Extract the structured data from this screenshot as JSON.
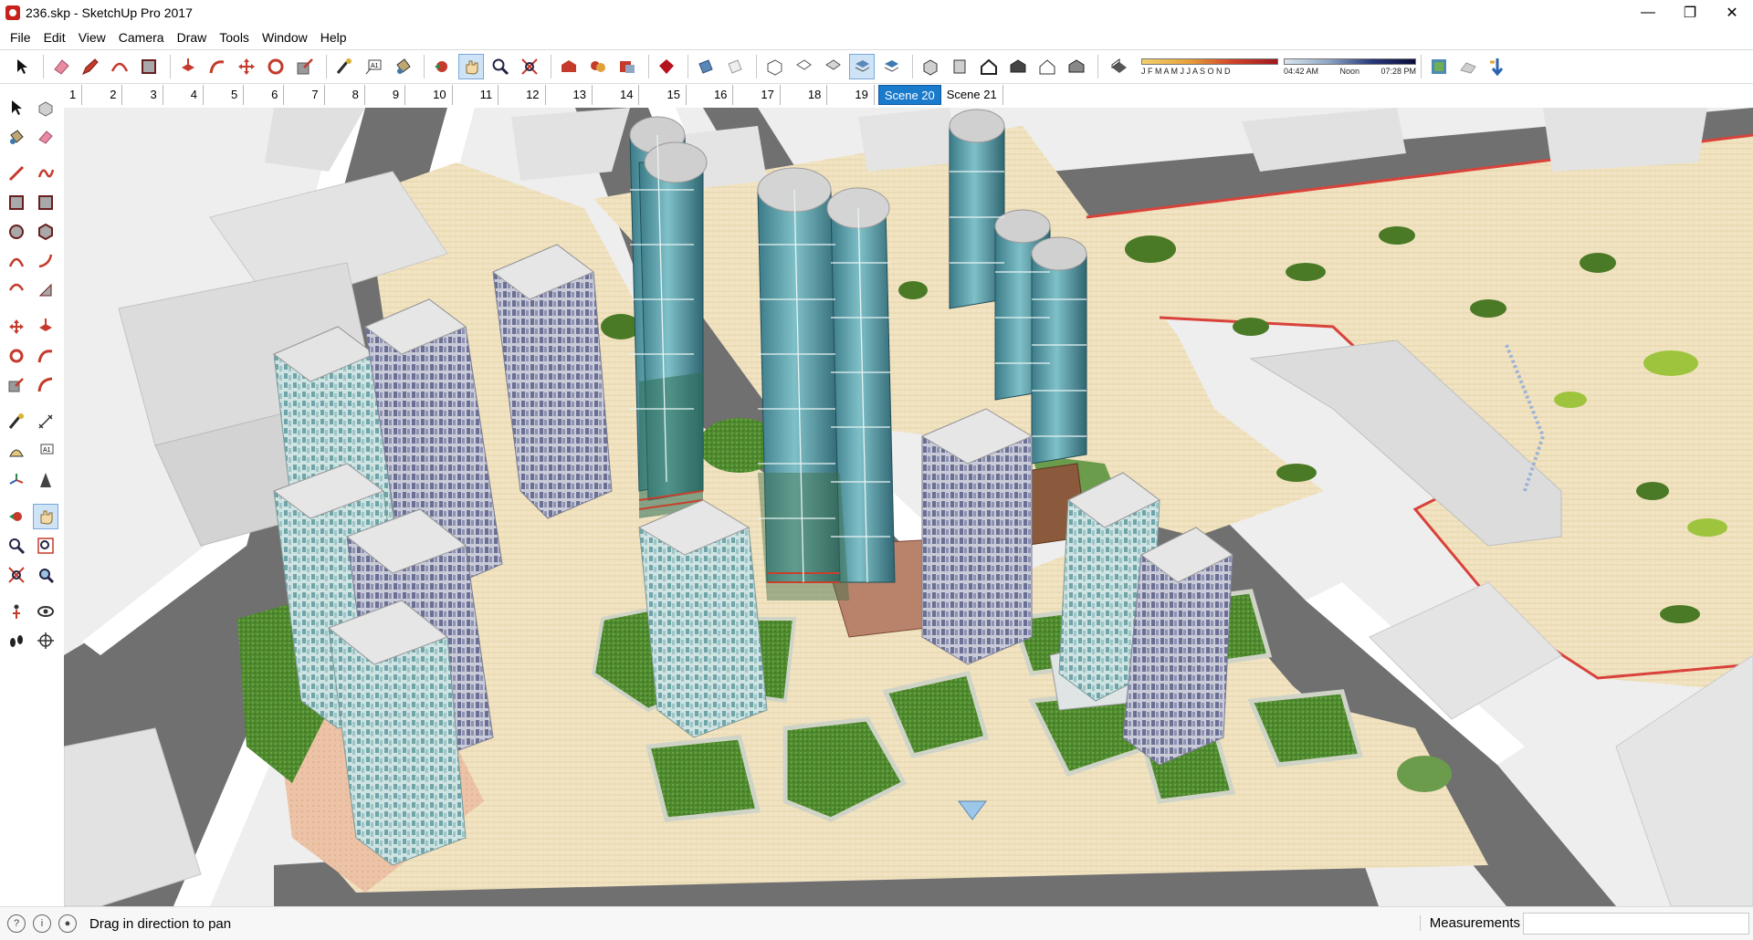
{
  "window": {
    "title": "236.skp - SketchUp Pro 2017",
    "controls": {
      "minimize": "—",
      "restore": "❐",
      "close": "✕"
    }
  },
  "menu": {
    "items": [
      "File",
      "Edit",
      "View",
      "Camera",
      "Draw",
      "Tools",
      "Window",
      "Help"
    ]
  },
  "toolbar": {
    "icons": [
      "select-icon",
      "eraser-icon",
      "pencil-icon",
      "shape-icon",
      "paint-bucket-icon",
      "push-pull-icon",
      "follow-me-icon",
      "move-icon",
      "rotate-icon",
      "scale-icon",
      "tape-measure-icon",
      "text-icon",
      "paint-icon",
      "orbit-icon",
      "pan-icon",
      "zoom-icon",
      "zoom-extents-icon",
      "warehouse-icon",
      "extension-icon",
      "share-icon",
      "ruby-icon"
    ],
    "shadow": {
      "months": "J F M A M J J A S O N D",
      "time_start": "04:42 AM",
      "time_mid": "Noon",
      "time_end": "07:28 PM"
    }
  },
  "scenes": {
    "tabs": [
      "1",
      "2",
      "3",
      "4",
      "5",
      "6",
      "7",
      "8",
      "9",
      "10",
      "11",
      "12",
      "13",
      "14",
      "15",
      "16",
      "17",
      "18",
      "19",
      "Scene 20",
      "Scene 21"
    ],
    "active": "Scene 20"
  },
  "status": {
    "message": "Drag in direction to pan",
    "measurements_label": "Measurements",
    "measurements_value": ""
  },
  "colors": {
    "accent": "#1a7acb",
    "ground": "#f3e6c6",
    "road": "#6e6e6e",
    "sidewalk": "#ffffff",
    "glass": "#5a9aa6",
    "grass": "#4e7a2c",
    "site_border": "#d9423b"
  }
}
